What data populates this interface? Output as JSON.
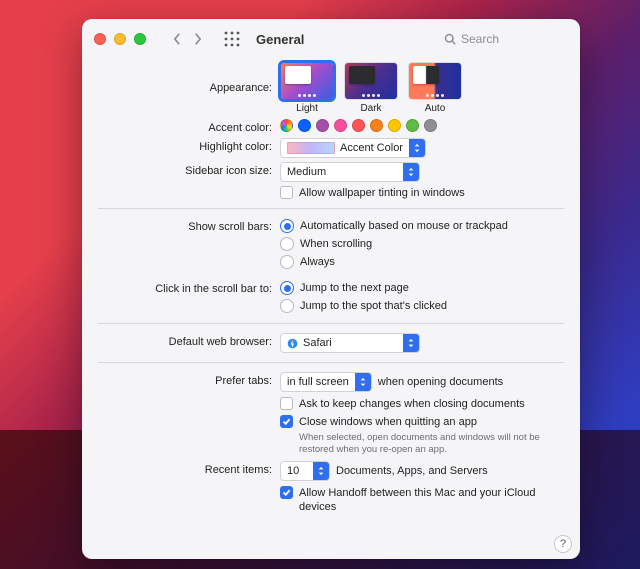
{
  "window": {
    "title": "General"
  },
  "search": {
    "placeholder": "Search"
  },
  "labels": {
    "appearance": "Appearance:",
    "accent_color": "Accent color:",
    "highlight_color": "Highlight color:",
    "sidebar_icon_size": "Sidebar icon size:",
    "show_scroll_bars": "Show scroll bars:",
    "click_scroll_bar": "Click in the scroll bar to:",
    "default_browser": "Default web browser:",
    "prefer_tabs": "Prefer tabs:",
    "recent_items": "Recent items:"
  },
  "appearance": {
    "options": [
      "Light",
      "Dark",
      "Auto"
    ],
    "selected": "Light"
  },
  "accent_colors": [
    "multicolor",
    "#0a60ff",
    "#a550a7",
    "#f74f9e",
    "#ff5257",
    "#f7821b",
    "#ffc600",
    "#62ba46",
    "#8e8e93"
  ],
  "highlight": {
    "value": "Accent Color"
  },
  "sidebar_size": {
    "value": "Medium"
  },
  "wallpaper_tint": {
    "label": "Allow wallpaper tinting in windows",
    "checked": false
  },
  "scroll_bars": {
    "options": [
      "Automatically based on mouse or trackpad",
      "When scrolling",
      "Always"
    ],
    "selected": 0
  },
  "click_scroll": {
    "options": [
      "Jump to the next page",
      "Jump to the spot that's clicked"
    ],
    "selected": 0
  },
  "browser": {
    "value": "Safari"
  },
  "prefer_tabs": {
    "value": "in full screen",
    "suffix": "when opening documents"
  },
  "ask_keep_changes": {
    "label": "Ask to keep changes when closing documents",
    "checked": false
  },
  "close_windows": {
    "label": "Close windows when quitting an app",
    "hint": "When selected, open documents and windows will not be restored when you re-open an app.",
    "checked": true
  },
  "recent_items": {
    "value": "10",
    "suffix": "Documents, Apps, and Servers"
  },
  "handoff": {
    "label": "Allow Handoff between this Mac and your iCloud devices",
    "checked": true
  },
  "help": "?"
}
